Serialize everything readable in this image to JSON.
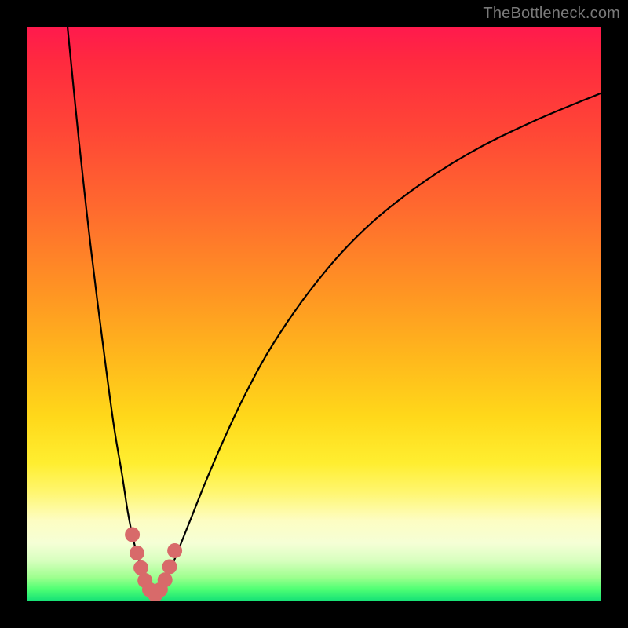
{
  "watermark": "TheBottleneck.com",
  "chart_data": {
    "type": "line",
    "title": "",
    "xlabel": "",
    "ylabel": "",
    "xlim": [
      0,
      100
    ],
    "ylim": [
      0,
      100
    ],
    "grid": false,
    "legend": false,
    "left_branch": {
      "name": "curve-left",
      "x": [
        7,
        9,
        11,
        13,
        15,
        16.5,
        17.5,
        18.5,
        19.5,
        20.2,
        20.8,
        21.3
      ],
      "y": [
        100,
        80,
        62,
        46,
        31,
        22,
        15.5,
        10.5,
        7,
        4.5,
        2.8,
        1.5
      ]
    },
    "right_branch": {
      "name": "curve-right",
      "x": [
        23.2,
        23.8,
        24.6,
        25.6,
        27,
        28.6,
        31,
        34,
        38,
        43,
        50,
        58,
        67,
        77,
        88,
        100
      ],
      "y": [
        1.5,
        2.8,
        4.6,
        7,
        10.5,
        14.5,
        20.5,
        27.5,
        36,
        45,
        55,
        64,
        71.5,
        78,
        83.5,
        88.5
      ]
    },
    "floor": {
      "name": "curve-floor",
      "x": [
        21.3,
        21.8,
        22.3,
        22.8,
        23.2
      ],
      "y": [
        1.5,
        0.8,
        0.6,
        0.8,
        1.5
      ]
    },
    "markers": {
      "name": "data-markers",
      "color": "#d86a6a",
      "radius_pct": 1.3,
      "points": [
        {
          "x": 18.3,
          "y": 11.5
        },
        {
          "x": 19.1,
          "y": 8.3
        },
        {
          "x": 19.8,
          "y": 5.7
        },
        {
          "x": 20.5,
          "y": 3.5
        },
        {
          "x": 21.3,
          "y": 1.9
        },
        {
          "x": 22.3,
          "y": 1.0
        },
        {
          "x": 23.2,
          "y": 1.9
        },
        {
          "x": 24.0,
          "y": 3.6
        },
        {
          "x": 24.8,
          "y": 5.9
        },
        {
          "x": 25.7,
          "y": 8.7
        }
      ]
    }
  }
}
